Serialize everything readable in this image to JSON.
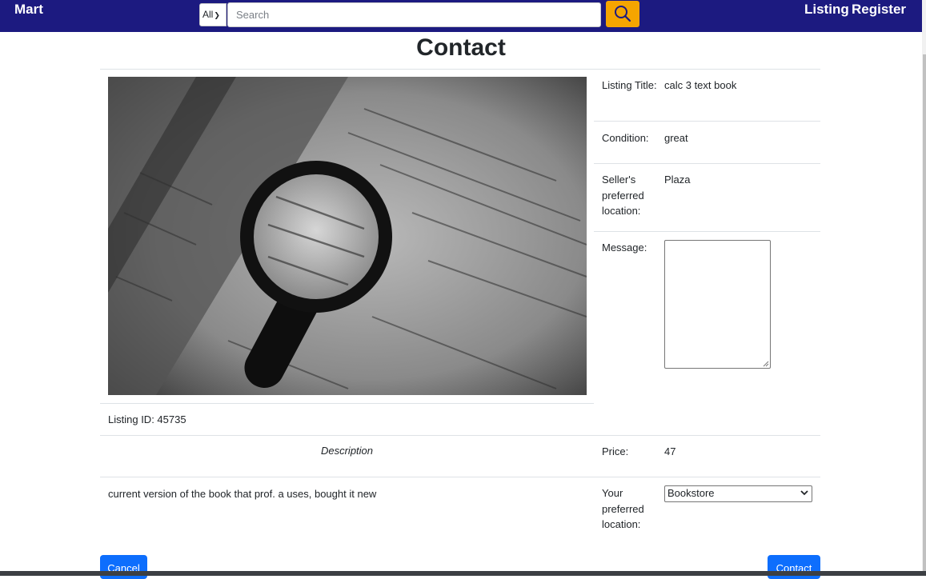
{
  "nav": {
    "brand": "Mart",
    "category_value": "All",
    "search_placeholder": "Search",
    "links": [
      "Listing",
      "Register"
    ]
  },
  "page": {
    "title": "Contact",
    "listing_id_label": "Listing ID: 45735",
    "description_heading": "Description",
    "description_text": "current version of the book that prof. a uses, bought it new"
  },
  "details": {
    "listing_title_label": "Listing Title:",
    "listing_title_value": "calc 3 text book",
    "condition_label": "Condition:",
    "condition_value": "great",
    "seller_location_label": "Seller's preferred location:",
    "seller_location_value": "Plaza",
    "message_label": "Message:",
    "message_value": "",
    "price_label": "Price:",
    "price_value": "47",
    "your_location_label": "Your preferred location:",
    "your_location_value": "Bookstore"
  },
  "buttons": {
    "cancel": "Cancel",
    "contact": "Contact"
  },
  "colors": {
    "navbar": "#1c1a80",
    "search_button": "#f5a500",
    "primary_button": "#0d6efd"
  },
  "icons": {
    "search": "search-icon",
    "dropdown": "chevron-down-icon"
  }
}
